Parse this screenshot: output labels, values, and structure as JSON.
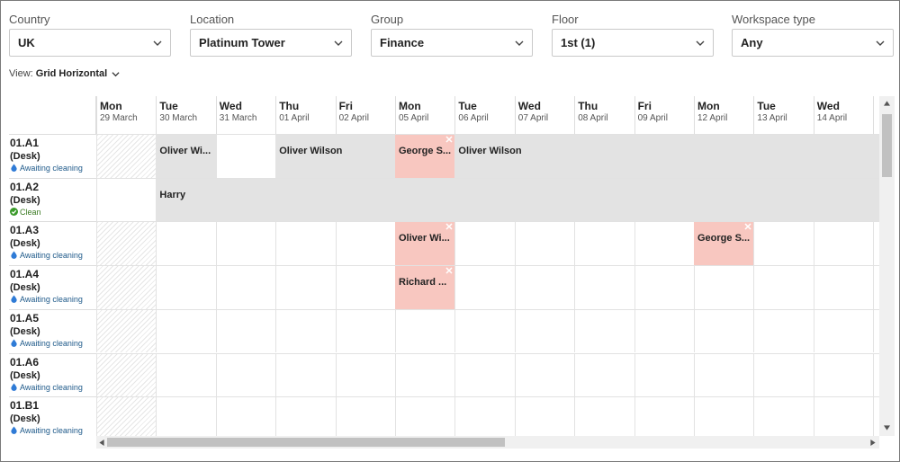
{
  "filters": [
    {
      "label": "Country",
      "value": "UK"
    },
    {
      "label": "Location",
      "value": "Platinum Tower"
    },
    {
      "label": "Group",
      "value": "Finance"
    },
    {
      "label": "Floor",
      "value": "1st (1)"
    },
    {
      "label": "Workspace type",
      "value": "Any"
    }
  ],
  "view": {
    "prefix": "View:",
    "value": "Grid Horizontal"
  },
  "days": [
    {
      "name": "Mon",
      "date": "29 March"
    },
    {
      "name": "Tue",
      "date": "30 March"
    },
    {
      "name": "Wed",
      "date": "31 March"
    },
    {
      "name": "Thu",
      "date": "01 April"
    },
    {
      "name": "Fri",
      "date": "02 April"
    },
    {
      "name": "Mon",
      "date": "05 April"
    },
    {
      "name": "Tue",
      "date": "06 April"
    },
    {
      "name": "Wed",
      "date": "07 April"
    },
    {
      "name": "Thu",
      "date": "08 April"
    },
    {
      "name": "Fri",
      "date": "09 April"
    },
    {
      "name": "Mon",
      "date": "12 April"
    },
    {
      "name": "Tue",
      "date": "13 April"
    },
    {
      "name": "Wed",
      "date": "14 April"
    }
  ],
  "rows": [
    {
      "name": "01.A1",
      "type": "(Desk)",
      "status": "Awaiting cleaning",
      "status_kind": "awaiting"
    },
    {
      "name": "01.A2",
      "type": "(Desk)",
      "status": "Clean",
      "status_kind": "clean"
    },
    {
      "name": "01.A3",
      "type": "(Desk)",
      "status": "Awaiting cleaning",
      "status_kind": "awaiting"
    },
    {
      "name": "01.A4",
      "type": "(Desk)",
      "status": "Awaiting cleaning",
      "status_kind": "awaiting"
    },
    {
      "name": "01.A5",
      "type": "(Desk)",
      "status": "Awaiting cleaning",
      "status_kind": "awaiting"
    },
    {
      "name": "01.A6",
      "type": "(Desk)",
      "status": "Awaiting cleaning",
      "status_kind": "awaiting"
    },
    {
      "name": "01.B1",
      "type": "(Desk)",
      "status": "Awaiting cleaning",
      "status_kind": "awaiting"
    }
  ],
  "bookings": [
    {
      "row": 0,
      "start": 1,
      "span": 1,
      "label": "Oliver Wi...",
      "kind": "grey"
    },
    {
      "row": 0,
      "start": 3,
      "span": 2,
      "label": "Oliver Wilson",
      "kind": "grey"
    },
    {
      "row": 0,
      "start": 5,
      "span": 1,
      "label": "George S...",
      "kind": "pink"
    },
    {
      "row": 0,
      "start": 6,
      "span": 8,
      "label": "Oliver Wilson",
      "kind": "grey"
    },
    {
      "row": 1,
      "start": 1,
      "span": 13,
      "label": "Harry",
      "kind": "grey"
    },
    {
      "row": 2,
      "start": 5,
      "span": 1,
      "label": "Oliver Wi...",
      "kind": "pink"
    },
    {
      "row": 2,
      "start": 10,
      "span": 1,
      "label": "George S...",
      "kind": "pink"
    },
    {
      "row": 3,
      "start": 5,
      "span": 1,
      "label": "Richard ...",
      "kind": "pink"
    }
  ],
  "hatched_cells": [
    {
      "row": 0,
      "col": 0
    },
    {
      "row": 2,
      "col": 0
    },
    {
      "row": 3,
      "col": 0
    },
    {
      "row": 4,
      "col": 0
    },
    {
      "row": 5,
      "col": 0
    },
    {
      "row": 6,
      "col": 0
    }
  ],
  "colors": {
    "booked_grey": "#e3e3e3",
    "booked_pink": "#f8c7c0",
    "awaiting": "#1f5a8a",
    "clean": "#3a9a2a"
  },
  "icons": {
    "awaiting": "water-drop-icon",
    "clean": "check-circle-icon",
    "remove": "close-icon",
    "dropdown": "chevron-down-icon"
  }
}
